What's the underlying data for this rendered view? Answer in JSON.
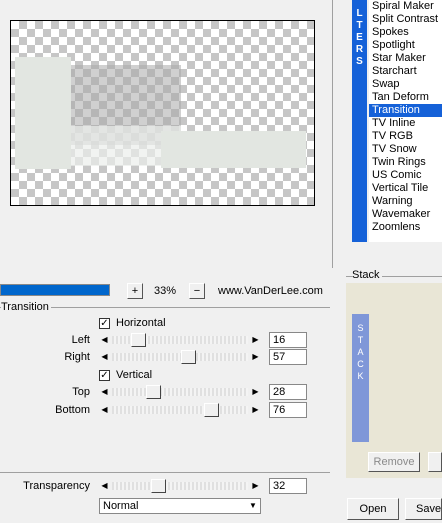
{
  "filters": {
    "strip_label": "LTERS",
    "items": [
      "Spiral Maker",
      "Split Contrast",
      "Spokes",
      "Spotlight",
      "Star Maker",
      "Starchart",
      "Swap",
      "Tan Deform",
      "Transition",
      "TV Inline",
      "TV RGB",
      "TV Snow",
      "Twin Rings",
      "US Comic",
      "Vertical Tile",
      "Warning",
      "Wavemaker",
      "Zoomlens"
    ],
    "selected": "Transition"
  },
  "toolbar": {
    "progress": 1.0,
    "zoom_plus": "+",
    "zoom_value": "33%",
    "zoom_minus": "−",
    "website": "www.VanDerLee.com"
  },
  "transition": {
    "group_label": "Transition",
    "horizontal": {
      "label": "Horizontal",
      "checked": true
    },
    "left": {
      "label": "Left",
      "value": "16",
      "level": 0.16
    },
    "right": {
      "label": "Right",
      "value": "57",
      "level": 0.57
    },
    "vertical": {
      "label": "Vertical",
      "checked": true
    },
    "top": {
      "label": "Top",
      "value": "28",
      "level": 0.28
    },
    "bottom": {
      "label": "Bottom",
      "value": "76",
      "level": 0.76
    }
  },
  "blend": {
    "transparency": {
      "label": "Transparency",
      "value": "32",
      "level": 0.32
    },
    "mode": "Normal"
  },
  "stack": {
    "label": "Stack",
    "strip_label": "STACK",
    "remove_button": "Remove",
    "open_button": "Open",
    "save_button": "Save"
  }
}
